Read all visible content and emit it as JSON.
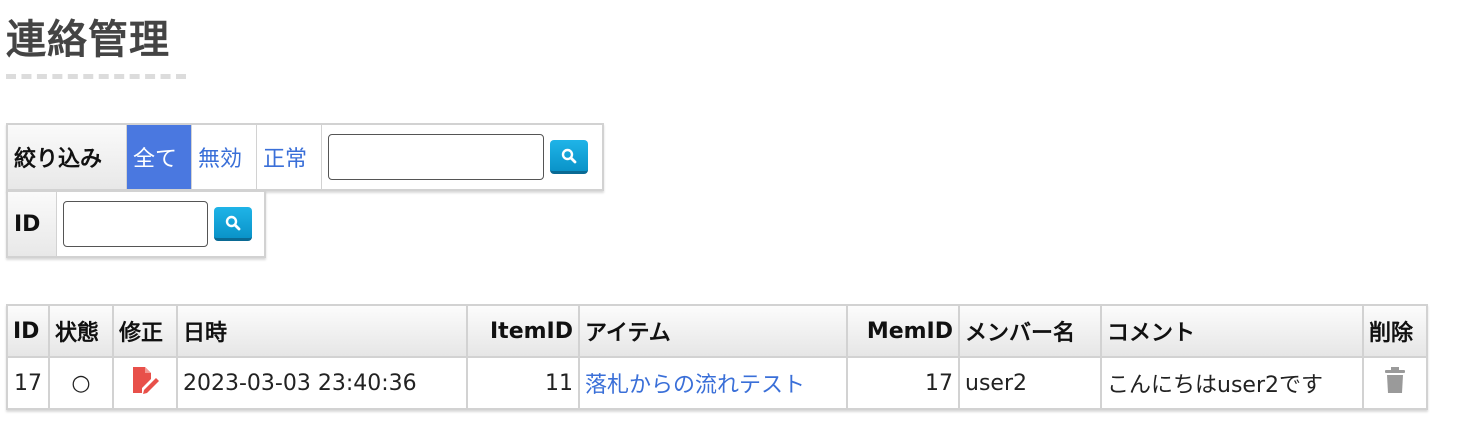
{
  "page": {
    "title": "連絡管理"
  },
  "filter": {
    "label": "絞り込み",
    "options": [
      "全て",
      "無効",
      "正常"
    ],
    "active_option": "全て",
    "search_value": "",
    "id_label": "ID",
    "id_value": ""
  },
  "colors": {
    "accent": "#4a78e0",
    "link": "#3a6fd8",
    "search_button": "#0fa3d8",
    "edit_icon": "#e8504a",
    "trash_icon": "#9a9a9a"
  },
  "table": {
    "headers": {
      "id": "ID",
      "status": "状態",
      "edit": "修正",
      "datetime": "日時",
      "item_id": "ItemID",
      "item": "アイテム",
      "mem_id": "MemID",
      "member_name": "メンバー名",
      "comment": "コメント",
      "delete": "削除"
    },
    "rows": [
      {
        "id": "17",
        "status": "○",
        "datetime": "2023-03-03 23:40:36",
        "item_id": "11",
        "item": "落札からの流れテスト",
        "mem_id": "17",
        "member_name": "user2",
        "comment": "こんにちはuser2です"
      }
    ]
  },
  "icons": {
    "search": "search-icon",
    "edit": "edit-document-icon",
    "delete": "trash-icon"
  }
}
